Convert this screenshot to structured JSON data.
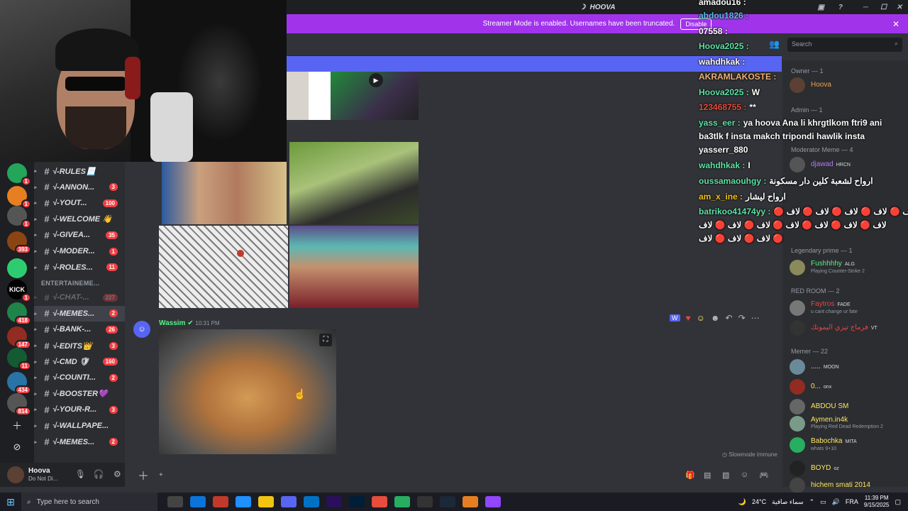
{
  "window": {
    "title": "HOOVA",
    "banner_text": "Streamer Mode is enabled. Usernames have been truncated.",
    "banner_button": "Disable",
    "search_placeholder": "Search"
  },
  "channels": [
    {
      "name": "√-RULES📃",
      "badge": "",
      "icon": "rules-icon"
    },
    {
      "name": "√-ANNON...",
      "badge": "3",
      "icon": "megaphone-icon"
    },
    {
      "name": "√-YOUT...",
      "badge": "100",
      "icon": "hash-icon"
    },
    {
      "name": "√-WELCOME 👋",
      "badge": "",
      "icon": "hash-icon"
    },
    {
      "name": "√-GIVEA...",
      "badge": "35",
      "icon": "hash-icon"
    },
    {
      "name": "√-MODER...",
      "badge": "1",
      "icon": "hash-icon"
    },
    {
      "name": "√-ROLES...",
      "badge": "11",
      "icon": "hash-icon"
    }
  ],
  "category": "ENTERTAINEME...",
  "channels2": [
    {
      "name": "√-CHAT-...",
      "badge": "227",
      "faded": true
    },
    {
      "name": "√-MEMES...",
      "badge": "2",
      "selected": true
    },
    {
      "name": "√-BANK-...",
      "badge": "26"
    },
    {
      "name": "√-EDITS👑",
      "badge": "3"
    },
    {
      "name": "√-CMD 🛡",
      "badge": "160"
    },
    {
      "name": "√-COUNTI...",
      "badge": "2"
    },
    {
      "name": "√-BOOSTER💜",
      "badge": ""
    },
    {
      "name": "√-YOUR-R...",
      "badge": "3"
    },
    {
      "name": "√-WALLPAPE...",
      "badge": ""
    },
    {
      "name": "√-MEMES...",
      "badge": "2"
    }
  ],
  "servers": [
    {
      "badge": "1",
      "color": "#23a55a",
      "label": ""
    },
    {
      "badge": "1",
      "color": "#e67e22",
      "label": ""
    },
    {
      "badge": "1",
      "color": "#555",
      "label": ""
    },
    {
      "badge": "393",
      "color": "#8b4513",
      "label": ""
    },
    {
      "badge": "",
      "color": "#2ecc71",
      "label": ""
    },
    {
      "badge": "1",
      "color": "#000",
      "label": "KICK"
    },
    {
      "badge": "418",
      "color": "#1e8449",
      "label": ""
    },
    {
      "badge": "147",
      "color": "#922b21",
      "label": ""
    },
    {
      "badge": "11",
      "color": "#145a32",
      "label": ""
    },
    {
      "badge": "434",
      "color": "#2874a6",
      "label": ""
    },
    {
      "badge": "814",
      "color": "#555",
      "label": ""
    }
  ],
  "user": {
    "name": "Hoova",
    "status": "Do Not Di..."
  },
  "message": {
    "author": "Wassim",
    "time": "10:31 PM",
    "slowmode": "Slowmode Immune"
  },
  "chat": [
    {
      "user": "amadou16 :",
      "text": "",
      "color": "#ffffff"
    },
    {
      "user": "abdou1826 :",
      "text": "",
      "color": "#5bc0de"
    },
    {
      "user": "07558 :",
      "text": "",
      "color": "#ffffff"
    },
    {
      "user": "Hoova2025 :",
      "text": "",
      "color": "#5ee3a6"
    },
    {
      "user": "wahdhkak :",
      "text": "",
      "color": "#ffffff"
    },
    {
      "user": "AKRAMLAKOSTE :",
      "text": "",
      "color": "#f0b27a"
    },
    {
      "user": "Hoova2025 :",
      "text": "W",
      "color": "#5ee3a6"
    },
    {
      "user": "123468755 :",
      "text": "**",
      "color": "#e74c3c"
    },
    {
      "user": "yass_eer :",
      "text": "ya hoova Ana li khrgtlkom ftri9 ani",
      "color": "#5ee3a6"
    },
    {
      "user": "",
      "text": "ba3tlk f insta makch tripondi hawlik insta",
      "color": "#ffffff"
    },
    {
      "user": "",
      "text": "yasserr_880",
      "color": "#ffffff"
    },
    {
      "user": "wahdhkak :",
      "text": "I",
      "color": "#5ee3a6"
    },
    {
      "user": "oussamaouhgy :",
      "text": "ارواح لشعبة كلين دار مسكونة",
      "color": "#5ee3a6"
    },
    {
      "user": "am_x_ine :",
      "text": "ارواح ليشار",
      "color": "#f1c40f"
    },
    {
      "user": "batrikoo41474yy :",
      "text": "🔴 لاف 🔴 لاف 🔴 لاف 🔴 لاف 🔴 لاف",
      "color": "#5ee3a6"
    },
    {
      "user": "",
      "text": "لاف 🔴 لاف 🔴 لاف 🔴 لاف 🔴 لاف 🔴 لاف 🔴 لاف",
      "color": "#ffffff"
    },
    {
      "user": "",
      "text": "لاف 🔴 لاف 🔴 لاف 🔴",
      "color": "#ffffff"
    }
  ],
  "members": {
    "owner_label": "Owner — 1",
    "admin_label": "Admin — 1",
    "moderator_label": "Moderator Meme — 4",
    "legendary_label": "Legendary prime — 1",
    "redroom_label": "RED ROOM — 2",
    "memer_label": "Memer — 22",
    "list": [
      {
        "name": "Hoova",
        "sub": "",
        "color": "#f0a04b",
        "tag": ""
      },
      {
        "name": "djawad",
        "sub": "",
        "color": "#b07cf0",
        "tag": "HRCN"
      },
      {
        "name": "Fushhhhy",
        "sub": "Playing Counter-Strike 2",
        "color": "#57f287",
        "tag": "ALG"
      },
      {
        "name": "Faytros",
        "sub": "u cant change ur fate",
        "color": "#ed4245",
        "tag": "FADE"
      },
      {
        "name": "فرماج تيزي اليموتك",
        "sub": "",
        "color": "#ed4245",
        "tag": "VT"
      },
      {
        "name": ".....",
        "sub": "",
        "color": "#fee75c",
        "tag": "MOON"
      },
      {
        "name": "0...",
        "sub": "",
        "color": "#fee75c",
        "tag": "onx"
      },
      {
        "name": "ABDOU SM",
        "sub": "",
        "color": "#fee75c",
        "tag": ""
      },
      {
        "name": "Aymen.in4k",
        "sub": "Playing Red Dead Redemption 2",
        "color": "#fee75c",
        "tag": ""
      },
      {
        "name": "Babochka",
        "sub": "whats 9+10",
        "color": "#fee75c",
        "tag": "MITA"
      },
      {
        "name": "BOYD",
        "sub": "",
        "color": "#fee75c",
        "tag": "oz"
      },
      {
        "name": "hichem smati 2014",
        "sub": "",
        "color": "#fee75c",
        "tag": ""
      }
    ]
  },
  "taskbar": {
    "search_placeholder": "Type here to search",
    "weather": "24°C",
    "weather_text": "سماء صافية",
    "lang": "FRA",
    "time": "11:39 PM",
    "date": "9/15/2025"
  }
}
